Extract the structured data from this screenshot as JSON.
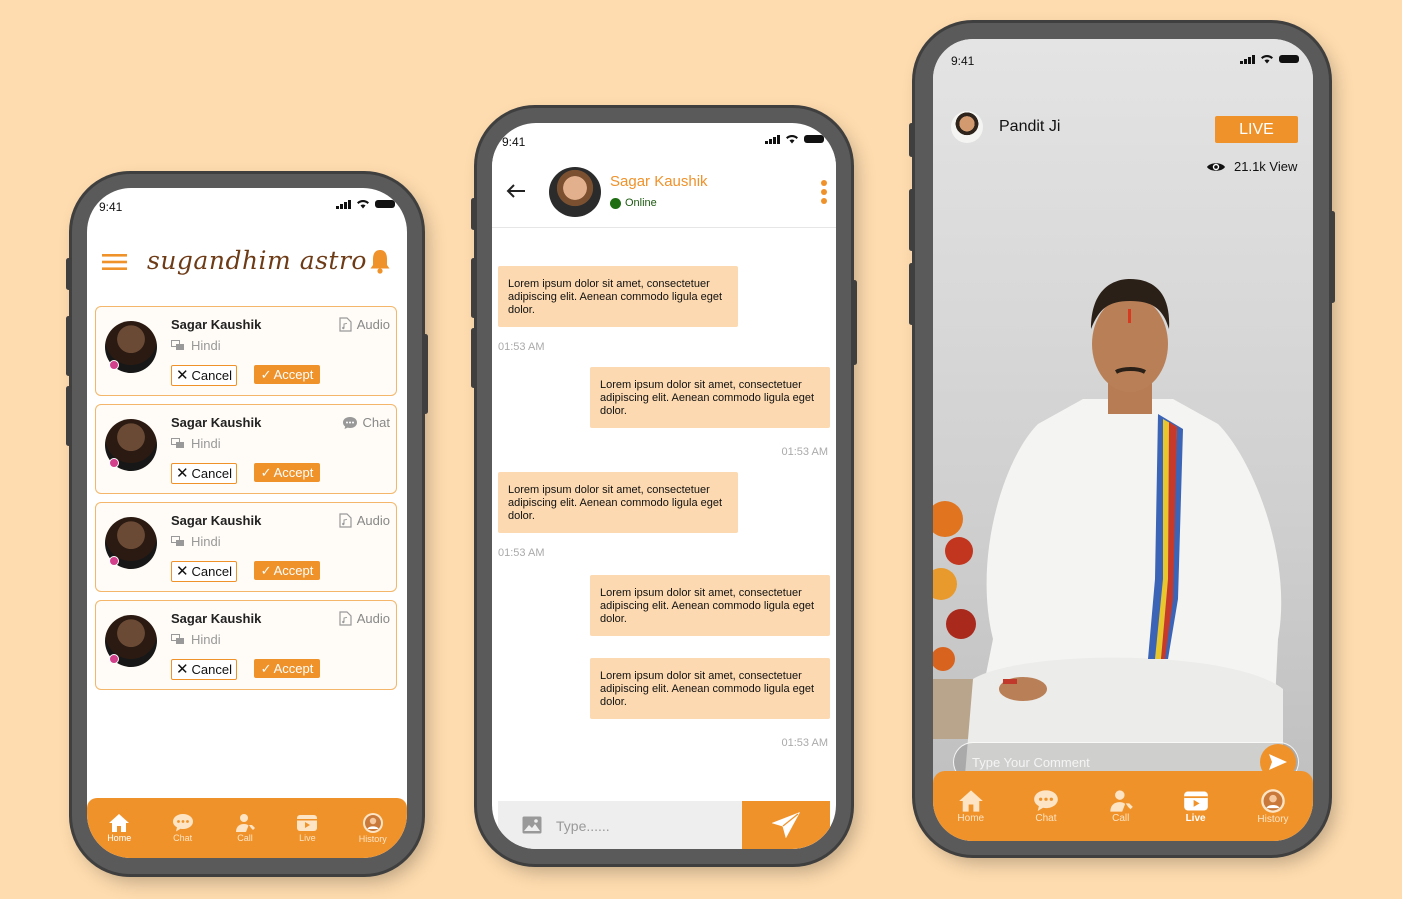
{
  "status_time": "9:41",
  "home": {
    "brand": "sugandhim astro",
    "requests": [
      {
        "name": "Sagar Kaushik",
        "language": "Hindi",
        "type": "Audio",
        "type_icon": "audio-icon",
        "cancel": "Cancel",
        "accept": "Accept"
      },
      {
        "name": "Sagar Kaushik",
        "language": "Hindi",
        "type": "Chat",
        "type_icon": "chat-icon",
        "cancel": "Cancel",
        "accept": "Accept"
      },
      {
        "name": "Sagar Kaushik",
        "language": "Hindi",
        "type": "Audio",
        "type_icon": "audio-icon",
        "cancel": "Cancel",
        "accept": "Accept"
      },
      {
        "name": "Sagar Kaushik",
        "language": "Hindi",
        "type": "Audio",
        "type_icon": "audio-icon",
        "cancel": "Cancel",
        "accept": "Accept"
      }
    ]
  },
  "nav": {
    "items": [
      "Home",
      "Chat",
      "Call",
      "Live",
      "History"
    ]
  },
  "chat": {
    "contact_name": "Sagar Kaushik",
    "status": "Online",
    "messages": [
      {
        "side": "in",
        "text": "Lorem ipsum dolor sit amet, consectetuer adipiscing elit. Aenean commodo ligula eget dolor.",
        "time": "01:53 AM"
      },
      {
        "side": "out",
        "text": "Lorem ipsum dolor sit amet, consectetuer adipiscing elit. Aenean commodo ligula eget dolor.",
        "time": "01:53 AM"
      },
      {
        "side": "in",
        "text": "Lorem ipsum dolor sit amet, consectetuer adipiscing elit. Aenean commodo ligula eget dolor.",
        "time": "01:53 AM"
      },
      {
        "side": "out",
        "text": "Lorem ipsum dolor sit amet, consectetuer adipiscing elit. Aenean commodo ligula eget dolor.",
        "time": ""
      },
      {
        "side": "out",
        "text": "Lorem ipsum dolor sit amet, consectetuer adipiscing elit. Aenean commodo ligula eget dolor.",
        "time": "01:53 AM"
      }
    ],
    "input_placeholder": "Type......"
  },
  "live": {
    "host_name": "Pandit Ji",
    "badge": "LIVE",
    "views": "21.1k View",
    "comment_placeholder": "Type Your Comment"
  },
  "colors": {
    "accent": "#F0922A",
    "background": "#FEDCAF",
    "bubble": "#FCD9B0"
  }
}
